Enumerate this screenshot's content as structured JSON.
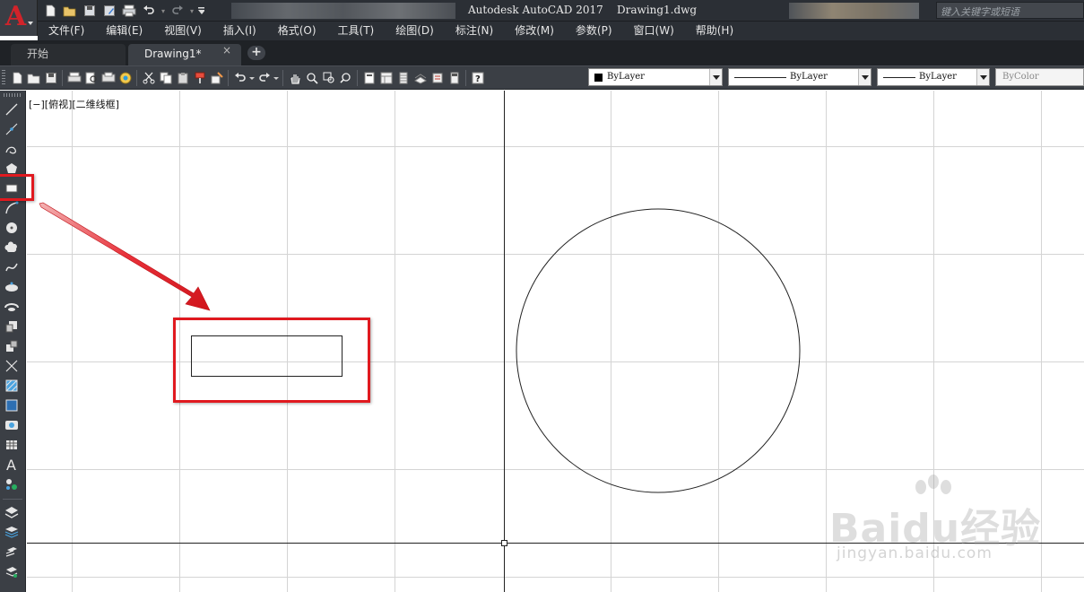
{
  "title_bar": {
    "app_title": "Autodesk AutoCAD 2017    Drawing1.dwg",
    "search_placeholder": "键入关键字或短语"
  },
  "menu": {
    "items": [
      "文件(F)",
      "编辑(E)",
      "视图(V)",
      "插入(I)",
      "格式(O)",
      "工具(T)",
      "绘图(D)",
      "标注(N)",
      "修改(M)",
      "参数(P)",
      "窗口(W)",
      "帮助(H)"
    ]
  },
  "tabs": {
    "start_label": "开始",
    "drawing_label": "Drawing1*",
    "close_glyph": "×",
    "add_glyph": "+"
  },
  "properties": {
    "layer": "ByLayer",
    "linetype": "ByLayer",
    "lineweight": "ByLayer",
    "color": "ByColor"
  },
  "canvas": {
    "viewport_label": "[−][俯视][二维线框]"
  },
  "watermark": {
    "brand": "Baidu经验",
    "url": "jingyan.baidu.com"
  },
  "colors": {
    "highlight": "#e0191f",
    "ui_dark": "#2b2f35",
    "toolbar": "#3b3f45",
    "grid_line": "#d4d4d4"
  }
}
